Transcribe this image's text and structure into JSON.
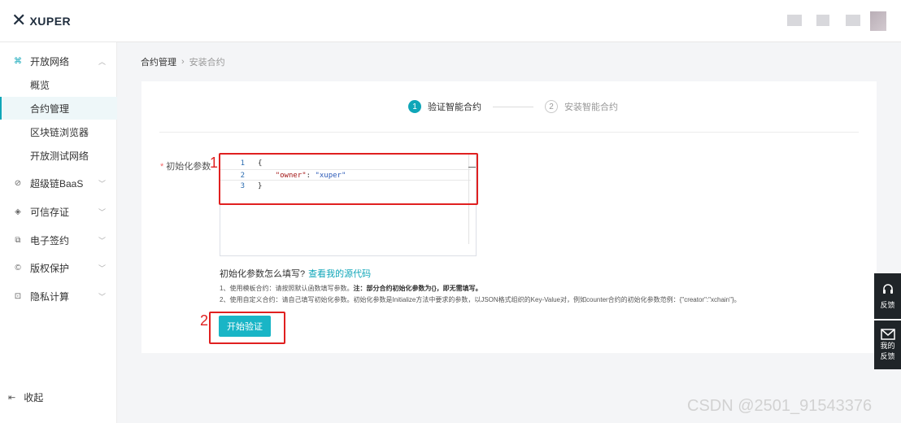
{
  "header": {
    "logo_text": "XUPER"
  },
  "sidebar": {
    "groups": [
      {
        "label": "开放网络",
        "icon": "network-icon",
        "expanded": true
      },
      {
        "label": "超级链BaaS",
        "icon": "baas-icon"
      },
      {
        "label": "可信存证",
        "icon": "shield-icon"
      },
      {
        "label": "电子签约",
        "icon": "sign-icon"
      },
      {
        "label": "版权保护",
        "icon": "copyright-icon"
      },
      {
        "label": "隐私计算",
        "icon": "lock-icon"
      }
    ],
    "sub_items": [
      {
        "label": "概览"
      },
      {
        "label": "合约管理",
        "active": true
      },
      {
        "label": "区块链浏览器"
      },
      {
        "label": "开放测试网络"
      }
    ],
    "collapse_label": "收起"
  },
  "breadcrumb": {
    "parent": "合约管理",
    "current": "安装合约"
  },
  "steps": [
    {
      "num": "1",
      "label": "验证智能合约",
      "active": true
    },
    {
      "num": "2",
      "label": "安装智能合约",
      "active": false
    }
  ],
  "form": {
    "init_label": "初始化参数",
    "code_lines": [
      {
        "ln": "1",
        "text": "{"
      },
      {
        "ln": "2",
        "key": "\"owner\"",
        "sep": ": ",
        "value": "\"xuper\""
      },
      {
        "ln": "3",
        "text": "}"
      }
    ],
    "help_title": "初始化参数怎么填写?",
    "help_link": "查看我的源代码",
    "help_1_prefix": "1、使用模板合约：请按照默认函数填写参数。",
    "help_1_bold": "注：部分合约初始化参数为{}，即无需填写。",
    "help_2": "2、使用自定义合约：请自己填写初始化参数。初始化参数是Initialize方法中要求的参数，以JSON格式组织的Key-Value对，例如counter合约的初始化参数范例：{\"creator\":\"xchain\"}。",
    "start_button": "开始验证"
  },
  "annotations": {
    "one": "1",
    "two": "2"
  },
  "floating": {
    "feedback": "反馈",
    "my_feedback_1": "我的",
    "my_feedback_2": "反馈"
  },
  "watermark": "CSDN @2501_91543376",
  "colors": {
    "accent": "#0fa6b8",
    "annotation": "#e02020",
    "float_bg": "#1f2428"
  }
}
